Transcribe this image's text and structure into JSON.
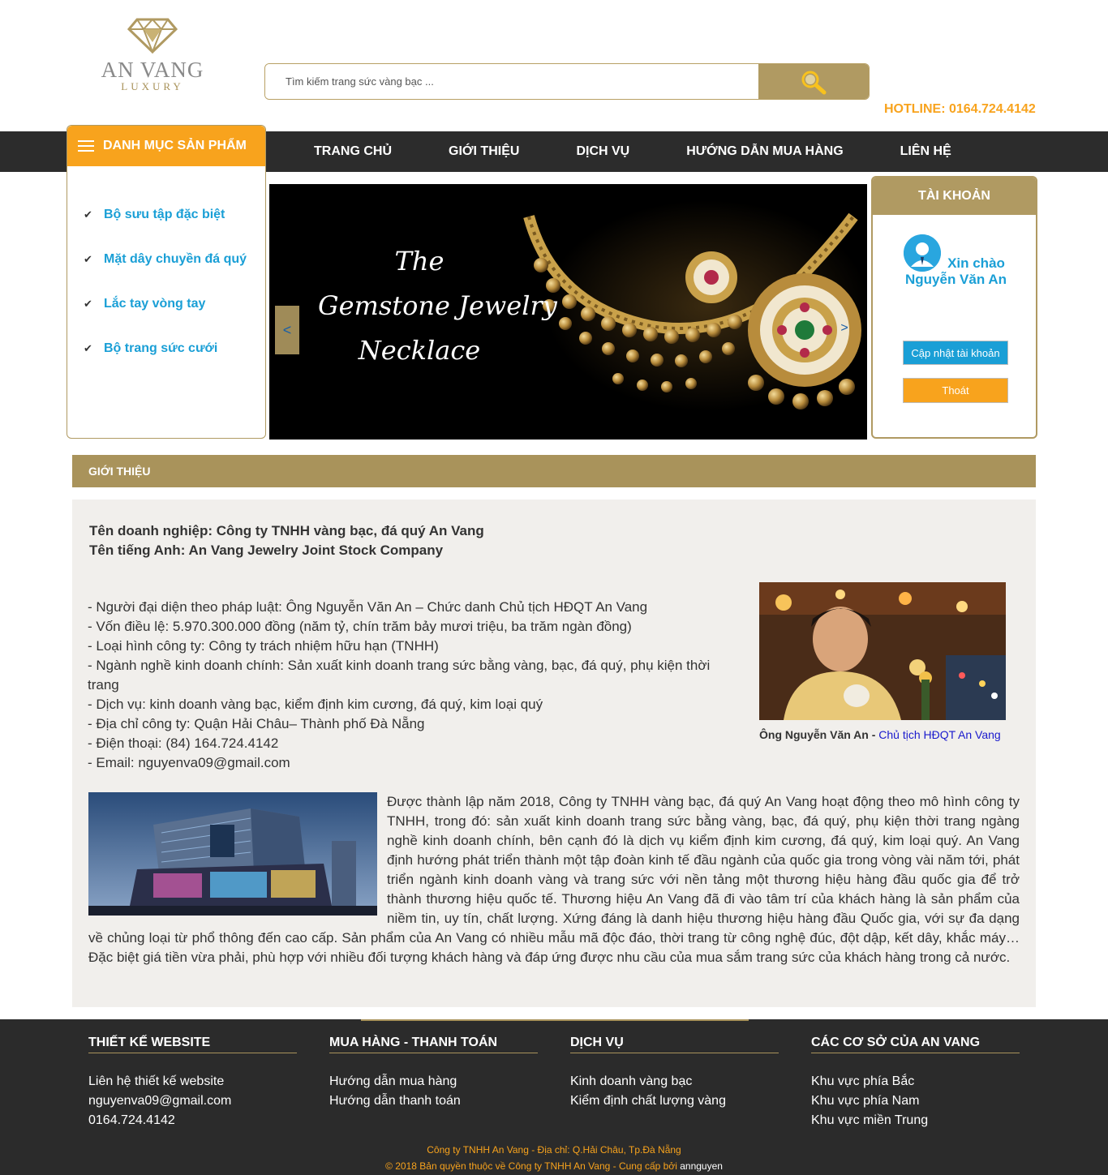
{
  "header": {
    "logo": {
      "name": "AN VANG",
      "tagline": "LUXURY"
    },
    "search": {
      "placeholder": "Tìm kiếm trang sức vàng bạc ..."
    },
    "hotline": "HOTLINE: 0164.724.4142"
  },
  "nav": {
    "items": [
      "TRANG CHỦ",
      "GIỚI THIỆU",
      "DỊCH VỤ",
      "HƯỚNG DẪN MUA HÀNG",
      "LIÊN HỆ"
    ]
  },
  "category": {
    "title": "DANH MỤC SẢN PHẨM",
    "items": [
      "Bộ sưu tập đặc biệt",
      "Mặt dây chuyền đá quý",
      "Lắc tay vòng tay",
      "Bộ trang sức cưới"
    ]
  },
  "banner": {
    "lines": [
      "The",
      "Gemstone Jewelry",
      "Necklace"
    ],
    "prev": "<",
    "next": ">"
  },
  "account": {
    "title": "TÀI KHOẢN",
    "greeting": "Xin chào",
    "user": "Nguyễn Văn An",
    "update_label": "Cập nhật tài khoản",
    "logout_label": "Thoát"
  },
  "intro": {
    "title": "GIỚI THIỆU",
    "company_name": "Tên doanh nghiệp: Công ty TNHH vàng bạc, đá quý An Vang",
    "english_name": "Tên tiếng Anh: An Vang Jewelry Joint Stock Company",
    "details": [
      "- Người đại diện theo pháp luật: Ông Nguyễn Văn An – Chức danh Chủ tịch HĐQT An Vang",
      "- Vốn điều lệ: 5.970.300.000 đồng (năm tỷ, chín trăm bảy mươi triệu, ba trăm ngàn đồng)",
      "- Loại hình công ty: Công ty trách nhiệm hữu hạn (TNHH)",
      "- Ngành nghề kinh doanh chính: Sản xuất kinh doanh trang sức bằng vàng, bạc, đá quý, phụ kiện thời trang",
      "- Dịch vụ: kinh doanh vàng bạc, kiểm định kim cương, đá quý, kim loại quý",
      "- Địa chỉ công ty: Quận Hải Châu– Thành phố Đà Nẵng",
      "- Điện thoại: (84) 164.724.4142",
      "- Email: nguyenva09@gmail.com"
    ],
    "caption_name": "Ông Nguyễn Văn An - ",
    "caption_role": "Chủ tịch HĐQT An Vang",
    "paragraph": "Được thành lập năm 2018, Công ty TNHH vàng bạc, đá quý An Vang hoạt động theo mô hình công ty TNHH, trong đó: sản xuất kinh doanh trang sức bằng vàng, bạc, đá quý, phụ kiện thời trang ngàng nghề kinh doanh chính, bên cạnh đó là dịch vụ kiểm định kim cương, đá quý, kim loại quý. An Vang định hướng phát triển thành một tập đoàn kinh tế đầu ngành của quốc gia trong vòng vài năm tới, phát triển ngành kinh doanh vàng và trang sức với nền tảng một thương hiệu hàng đầu quốc gia để trở thành thương hiệu quốc tế. Thương hiệu An Vang đã đi vào tâm trí của khách hàng là sản phẩm của niềm tin, uy tín, chất lượng. Xứng đáng là danh hiệu thương hiệu hàng đầu Quốc gia, với sự đa dạng về chủng loại từ phổ thông đến cao cấp. Sản phẩm của An Vang có nhiều mẫu mã độc đáo, thời trang từ công nghệ đúc, đột dập, kết dây, khắc máy… Đặc biệt giá tiền vừa phải, phù hợp với nhiều đối tượng khách hàng và đáp ứng được nhu cầu của mua sắm trang sức của khách hàng trong cả nước."
  },
  "footer": {
    "columns": [
      {
        "title": "THIẾT KẾ WEBSITE",
        "items": [
          "Liên hệ thiết kế website",
          "nguyenva09@gmail.com",
          "0164.724.4142"
        ]
      },
      {
        "title": "MUA HÀNG - THANH TOÁN",
        "items": [
          "Hướng dẫn mua hàng",
          "Hướng dẫn thanh toán"
        ]
      },
      {
        "title": "DỊCH VỤ",
        "items": [
          "Kinh doanh vàng bạc",
          "Kiểm định chất lượng vàng"
        ]
      },
      {
        "title": "CÁC CƠ SỞ CỦA AN VANG",
        "items": [
          "Khu vực phía Bắc",
          "Khu vực phía Nam",
          "Khu vực miền Trung"
        ]
      }
    ],
    "address": "Công ty TNHH An Vang - Địa chỉ: Q.Hải Châu, Tp.Đà Nẵng",
    "copyright": "© 2018 Bản quyền thuộc về Công ty TNHH An Vang - Cung cấp bởi ",
    "provider": "annguyen"
  },
  "colors": {
    "gold": "#b09a62",
    "orange": "#f8a31d",
    "blue": "#1a9fd6",
    "dark": "#2c2c2c"
  }
}
